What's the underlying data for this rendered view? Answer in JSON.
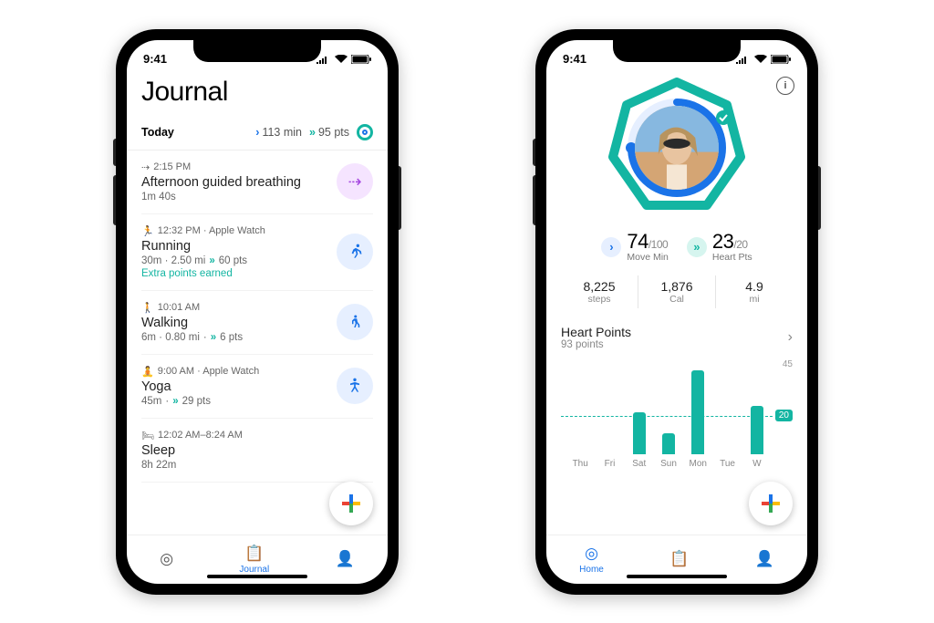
{
  "status": {
    "time": "9:41"
  },
  "journal": {
    "title": "Journal",
    "today_label": "Today",
    "today_min": "113 min",
    "today_pts": "95 pts",
    "entries": [
      {
        "meta": "2:15 PM",
        "name": "Afternoon guided breathing",
        "detail": "1m 40s",
        "pts": "",
        "extra": "",
        "icon": "breath"
      },
      {
        "meta": "12:32 PM · Apple Watch",
        "name": "Running",
        "detail": "30m · 2.50 mi",
        "pts": "60 pts",
        "extra": "Extra points earned",
        "icon": "run"
      },
      {
        "meta": "10:01 AM",
        "name": "Walking",
        "detail": "6m · 0.80 mi",
        "pts": "6 pts",
        "extra": "",
        "icon": "walk"
      },
      {
        "meta": "9:00 AM · Apple Watch",
        "name": "Yoga",
        "detail": "45m",
        "pts": "29 pts",
        "extra": "",
        "icon": "yoga"
      },
      {
        "meta": "12:02 AM–8:24 AM",
        "name": "Sleep",
        "detail": "8h 22m",
        "pts": "",
        "extra": "",
        "icon": "sleep"
      }
    ],
    "nav": {
      "home": "",
      "journal": "Journal",
      "profile": ""
    }
  },
  "home": {
    "move": {
      "value": "74",
      "max": "/100",
      "label": "Move Min"
    },
    "heart": {
      "value": "23",
      "max": "/20",
      "label": "Heart Pts"
    },
    "stats": [
      {
        "value": "8,225",
        "label": "steps"
      },
      {
        "value": "1,876",
        "label": "Cal"
      },
      {
        "value": "4.9",
        "label": "mi"
      }
    ],
    "hp_title": "Heart Points",
    "hp_sub": "93 points",
    "nav": {
      "home": "Home",
      "journal": "",
      "profile": ""
    }
  },
  "chart_data": {
    "type": "bar",
    "categories": [
      "Thu",
      "Fri",
      "Sat",
      "Sun",
      "Mon",
      "Tue",
      "W"
    ],
    "values": [
      0,
      0,
      22,
      11,
      44,
      0,
      25
    ],
    "title": "Heart Points",
    "xlabel": "",
    "ylabel": "",
    "ylim": [
      0,
      45
    ],
    "goal": 20,
    "ymax_label": "45",
    "goal_label": "20"
  }
}
